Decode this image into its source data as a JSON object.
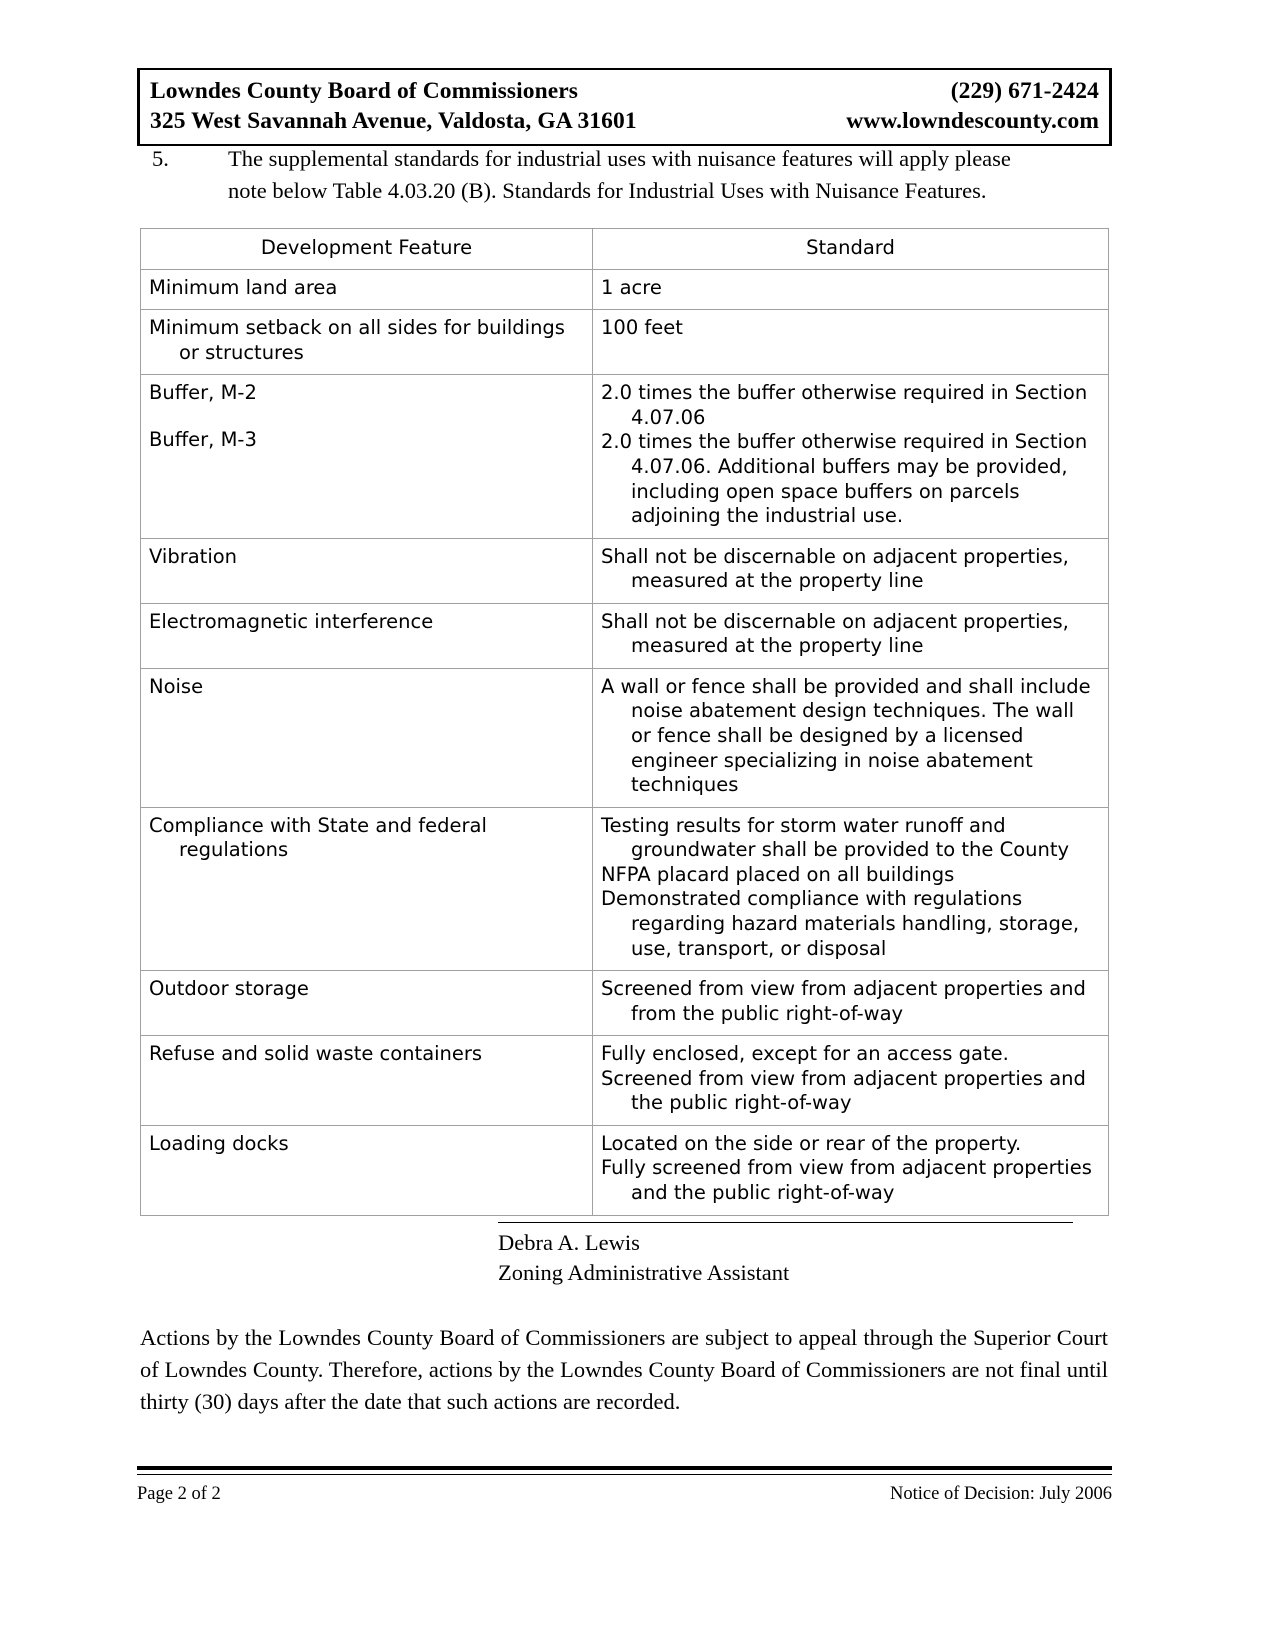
{
  "letterhead": {
    "org_name": "Lowndes County Board of Commissioners",
    "address": "325 West Savannah Avenue, Valdosta, GA  31601",
    "phone": "(229) 671-2424",
    "website": "www.lowndescounty.com"
  },
  "item": {
    "number": "5.",
    "line1": "The supplemental standards for industrial uses with nuisance features will apply please",
    "line2": "note below Table 4.03.20 (B).  Standards for Industrial Uses with Nuisance Features."
  },
  "table": {
    "headers": [
      "Development Feature",
      "Standard"
    ],
    "rows": [
      {
        "feature": [
          "Minimum land area"
        ],
        "standard": [
          "1 acre"
        ]
      },
      {
        "feature": [
          "Minimum setback on all sides for buildings or structures"
        ],
        "standard": [
          "100 feet"
        ]
      },
      {
        "feature": [
          "Buffer, M-2",
          "Buffer, M-3"
        ],
        "standard": [
          "2.0 times the buffer otherwise required in Section 4.07.06",
          "2.0 times the buffer otherwise required in Section 4.07.06.  Additional buffers may be provided, including open space buffers on parcels adjoining the industrial use."
        ]
      },
      {
        "feature": [
          "Vibration"
        ],
        "standard": [
          "Shall not be discernable on adjacent properties, measured at the property line"
        ]
      },
      {
        "feature": [
          "Electromagnetic interference"
        ],
        "standard": [
          "Shall not be discernable on adjacent properties, measured at the property line"
        ]
      },
      {
        "feature": [
          "Noise"
        ],
        "standard": [
          "A wall or fence shall be provided and shall include noise abatement design techniques.  The wall or fence shall be designed by a licensed engineer specializing in noise abatement techniques"
        ]
      },
      {
        "feature": [
          "Compliance with State and federal regulations"
        ],
        "standard": [
          "Testing results for storm water runoff and groundwater shall be provided to the County",
          "NFPA placard placed on all buildings",
          "Demonstrated compliance with regulations regarding hazard materials handling, storage, use, transport, or disposal"
        ]
      },
      {
        "feature": [
          "Outdoor storage"
        ],
        "standard": [
          "Screened from view from adjacent properties and from the public right-of-way"
        ]
      },
      {
        "feature": [
          "Refuse and solid waste containers"
        ],
        "standard": [
          "Fully enclosed, except for an access gate.",
          "Screened from view from adjacent properties and the public right-of-way"
        ]
      },
      {
        "feature": [
          "Loading docks"
        ],
        "standard": [
          "Located on the side or rear of the property.",
          "Fully screened from view from adjacent properties and the public right-of-way"
        ]
      }
    ]
  },
  "signature": {
    "name": "Debra A. Lewis",
    "title": "Zoning Administrative Assistant"
  },
  "closing": {
    "text": "Actions by the Lowndes County Board of Commissioners are subject to appeal through the Superior Court of Lowndes County.  Therefore, actions by the Lowndes County Board of Commissioners are not final until thirty (30) days after the date that such actions are recorded."
  },
  "footer": {
    "page": "Page 2 of 2",
    "document": "Notice of Decision:  July 2006"
  }
}
